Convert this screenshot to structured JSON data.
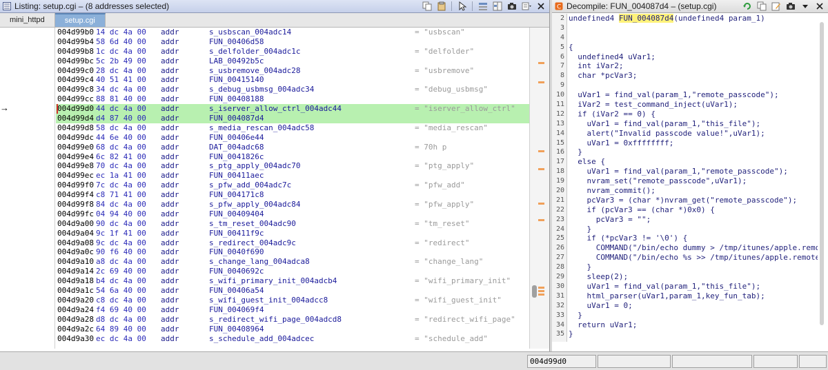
{
  "listing": {
    "title": "Listing:  setup.cgi – (8 addresses selected)",
    "tabs": [
      {
        "label": "mini_httpd",
        "active": false
      },
      {
        "label": "setup.cgi",
        "active": true
      }
    ],
    "rows": [
      {
        "addr": "004d99b0",
        "bytes": "14 dc 4a 00",
        "mnemonic": "addr",
        "operand": "s_usbscan_004adc14",
        "comment": "= \"usbscan\"",
        "selected": false
      },
      {
        "addr": "004d99b4",
        "bytes": "58 6d 40 00",
        "mnemonic": "addr",
        "operand": "FUN_00406d58",
        "comment": "",
        "selected": false
      },
      {
        "addr": "004d99b8",
        "bytes": "1c dc 4a 00",
        "mnemonic": "addr",
        "operand": "s_delfolder_004adc1c",
        "comment": "= \"delfolder\"",
        "selected": false
      },
      {
        "addr": "004d99bc",
        "bytes": "5c 2b 49 00",
        "mnemonic": "addr",
        "operand": "LAB_00492b5c",
        "comment": "",
        "selected": false
      },
      {
        "addr": "004d99c0",
        "bytes": "28 dc 4a 00",
        "mnemonic": "addr",
        "operand": "s_usbremove_004adc28",
        "comment": "= \"usbremove\"",
        "selected": false
      },
      {
        "addr": "004d99c4",
        "bytes": "40 51 41 00",
        "mnemonic": "addr",
        "operand": "FUN_00415140",
        "comment": "",
        "selected": false
      },
      {
        "addr": "004d99c8",
        "bytes": "34 dc 4a 00",
        "mnemonic": "addr",
        "operand": "s_debug_usbmsg_004adc34",
        "comment": "= \"debug_usbmsg\"",
        "selected": false
      },
      {
        "addr": "004d99cc",
        "bytes": "88 81 40 00",
        "mnemonic": "addr",
        "operand": "FUN_00408188",
        "comment": "",
        "selected": false
      },
      {
        "addr": "004d99d0",
        "bytes": "44 dc 4a 00",
        "mnemonic": "addr",
        "operand": "s_iserver_allow_ctrl_004adc44",
        "comment": "= \"iserver_allow_ctrl\"",
        "selected": true
      },
      {
        "addr": "004d99d4",
        "bytes": "d4 87 40 00",
        "mnemonic": "addr",
        "operand": "FUN_004087d4",
        "comment": "",
        "selected": true
      },
      {
        "addr": "004d99d8",
        "bytes": "58 dc 4a 00",
        "mnemonic": "addr",
        "operand": "s_media_rescan_004adc58",
        "comment": "= \"media_rescan\"",
        "selected": false
      },
      {
        "addr": "004d99dc",
        "bytes": "44 6e 40 00",
        "mnemonic": "addr",
        "operand": "FUN_00406e44",
        "comment": "",
        "selected": false
      },
      {
        "addr": "004d99e0",
        "bytes": "68 dc 4a 00",
        "mnemonic": "addr",
        "operand": "DAT_004adc68",
        "comment": "= 70h    p",
        "selected": false
      },
      {
        "addr": "004d99e4",
        "bytes": "6c 82 41 00",
        "mnemonic": "addr",
        "operand": "FUN_0041826c",
        "comment": "",
        "selected": false
      },
      {
        "addr": "004d99e8",
        "bytes": "70 dc 4a 00",
        "mnemonic": "addr",
        "operand": "s_ptg_apply_004adc70",
        "comment": "= \"ptg_apply\"",
        "selected": false
      },
      {
        "addr": "004d99ec",
        "bytes": "ec 1a 41 00",
        "mnemonic": "addr",
        "operand": "FUN_00411aec",
        "comment": "",
        "selected": false
      },
      {
        "addr": "004d99f0",
        "bytes": "7c dc 4a 00",
        "mnemonic": "addr",
        "operand": "s_pfw_add_004adc7c",
        "comment": "= \"pfw_add\"",
        "selected": false
      },
      {
        "addr": "004d99f4",
        "bytes": "c8 71 41 00",
        "mnemonic": "addr",
        "operand": "FUN_004171c8",
        "comment": "",
        "selected": false
      },
      {
        "addr": "004d99f8",
        "bytes": "84 dc 4a 00",
        "mnemonic": "addr",
        "operand": "s_pfw_apply_004adc84",
        "comment": "= \"pfw_apply\"",
        "selected": false
      },
      {
        "addr": "004d99fc",
        "bytes": "04 94 40 00",
        "mnemonic": "addr",
        "operand": "FUN_00409404",
        "comment": "",
        "selected": false
      },
      {
        "addr": "004d9a00",
        "bytes": "90 dc 4a 00",
        "mnemonic": "addr",
        "operand": "s_tm_reset_004adc90",
        "comment": "= \"tm_reset\"",
        "selected": false
      },
      {
        "addr": "004d9a04",
        "bytes": "9c 1f 41 00",
        "mnemonic": "addr",
        "operand": "FUN_00411f9c",
        "comment": "",
        "selected": false
      },
      {
        "addr": "004d9a08",
        "bytes": "9c dc 4a 00",
        "mnemonic": "addr",
        "operand": "s_redirect_004adc9c",
        "comment": "= \"redirect\"",
        "selected": false
      },
      {
        "addr": "004d9a0c",
        "bytes": "90 f6 40 00",
        "mnemonic": "addr",
        "operand": "FUN_0040f690",
        "comment": "",
        "selected": false
      },
      {
        "addr": "004d9a10",
        "bytes": "a8 dc 4a 00",
        "mnemonic": "addr",
        "operand": "s_change_lang_004adca8",
        "comment": "= \"change_lang\"",
        "selected": false
      },
      {
        "addr": "004d9a14",
        "bytes": "2c 69 40 00",
        "mnemonic": "addr",
        "operand": "FUN_0040692c",
        "comment": "",
        "selected": false
      },
      {
        "addr": "004d9a18",
        "bytes": "b4 dc 4a 00",
        "mnemonic": "addr",
        "operand": "s_wifi_primary_init_004adcb4",
        "comment": "= \"wifi_primary_init\"",
        "selected": false
      },
      {
        "addr": "004d9a1c",
        "bytes": "54 6a 40 00",
        "mnemonic": "addr",
        "operand": "FUN_00406a54",
        "comment": "",
        "selected": false
      },
      {
        "addr": "004d9a20",
        "bytes": "c8 dc 4a 00",
        "mnemonic": "addr",
        "operand": "s_wifi_guest_init_004adcc8",
        "comment": "= \"wifi_guest_init\"",
        "selected": false
      },
      {
        "addr": "004d9a24",
        "bytes": "f4 69 40 00",
        "mnemonic": "addr",
        "operand": "FUN_004069f4",
        "comment": "",
        "selected": false
      },
      {
        "addr": "004d9a28",
        "bytes": "d8 dc 4a 00",
        "mnemonic": "addr",
        "operand": "s_redirect_wifi_page_004adcd8",
        "comment": "= \"redirect_wifi_page\"",
        "selected": false
      },
      {
        "addr": "004d9a2c",
        "bytes": "64 89 40 00",
        "mnemonic": "addr",
        "operand": "FUN_00408964",
        "comment": "",
        "selected": false
      },
      {
        "addr": "004d9a30",
        "bytes": "ec dc 4a 00",
        "mnemonic": "addr",
        "operand": "s_schedule_add_004adcec",
        "comment": "= \"schedule_add\"",
        "selected": false
      }
    ]
  },
  "decompile": {
    "title": "Decompile: FUN_004087d4 – (setup.cgi)",
    "function_name": "FUN_004087d4",
    "sig_prefix": "undefined4 ",
    "sig_suffix": "(undefined4 param_1)",
    "lines": [
      "",
      "",
      "{",
      "  undefined4 uVar1;",
      "  int iVar2;",
      "  char *pcVar3;",
      "",
      "  uVar1 = find_val(param_1,\"remote_passcode\");",
      "  iVar2 = test_command_inject(uVar1);",
      "  if (iVar2 == 0) {",
      "    uVar1 = find_val(param_1,\"this_file\");",
      "    alert(\"Invalid passcode value!\",uVar1);",
      "    uVar1 = 0xffffffff;",
      "  }",
      "  else {",
      "    uVar1 = find_val(param_1,\"remote_passcode\");",
      "    nvram_set(\"remote_passcode\",uVar1);",
      "    nvram_commit();",
      "    pcVar3 = (char *)nvram_get(\"remote_passcode\");",
      "    if (pcVar3 == (char *)0x0) {",
      "      pcVar3 = \"\";",
      "    }",
      "    if (*pcVar3 != '\\0') {",
      "      COMMAND(\"/bin/echo dummy > /tmp/itunes/apple.remote\")",
      "      COMMAND(\"/bin/echo %s >> /tmp/itunes/apple.remote\",pc",
      "    }",
      "    sleep(2);",
      "    uVar1 = find_val(param_1,\"this_file\");",
      "    html_parser(uVar1,param_1,key_fun_tab);",
      "    uVar1 = 0;",
      "  }",
      "  return uVar1;",
      "}",
      ""
    ],
    "line_numbers": [
      "2",
      "3",
      "4",
      "5",
      "6",
      "7",
      "8",
      "9",
      "10",
      "11",
      "12",
      "13",
      "14",
      "15",
      "16",
      "17",
      "18",
      "19",
      "20",
      "21",
      "22",
      "23",
      "24",
      "25",
      "26",
      "27",
      "28",
      "29",
      "30",
      "31",
      "32",
      "33",
      "34",
      "35"
    ]
  },
  "statusbar": {
    "address": "004d99d0"
  },
  "colors": {
    "selection": "#b8f0b0",
    "operand": "#1a1a9a",
    "comment": "#9a9a9a",
    "function_highlight": "#fff27a"
  }
}
